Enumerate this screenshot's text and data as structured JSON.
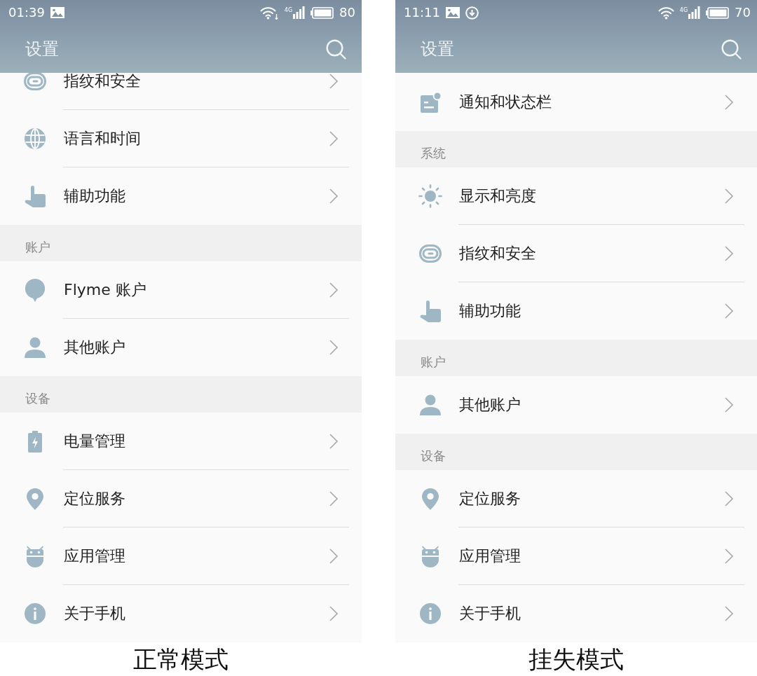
{
  "screens": [
    {
      "status_bar": {
        "time": "01:39",
        "notification_icons": [
          {
            "kind": "image"
          }
        ],
        "wifi_activity": true,
        "network": "4G",
        "battery": "80"
      },
      "app_bar": {
        "title": "设置"
      },
      "sections": [
        {
          "items": [
            {
              "label": "指纹和安全",
              "kind": "fingerprint"
            },
            {
              "label": "语言和时间",
              "kind": "globe"
            },
            {
              "label": "辅助功能",
              "kind": "hand"
            }
          ]
        },
        {
          "header": "账户",
          "items": [
            {
              "label": "Flyme 账户",
              "kind": "balloon"
            },
            {
              "label": "其他账户",
              "kind": "person"
            }
          ]
        },
        {
          "header": "设备",
          "items": [
            {
              "label": "电量管理",
              "kind": "battery"
            },
            {
              "label": "定位服务",
              "kind": "pin"
            },
            {
              "label": "应用管理",
              "kind": "android"
            },
            {
              "label": "关于手机",
              "kind": "info"
            }
          ]
        }
      ],
      "caption": "正常模式"
    },
    {
      "status_bar": {
        "time": "11:11",
        "notification_icons": [
          {
            "kind": "image"
          },
          {
            "kind": "download"
          }
        ],
        "wifi_activity": false,
        "network": "4G",
        "battery": "70"
      },
      "app_bar": {
        "title": "设置"
      },
      "sections": [
        {
          "items": [
            {
              "label": "通知和状态栏",
              "kind": "notification"
            }
          ]
        },
        {
          "header": "系统",
          "items": [
            {
              "label": "显示和亮度",
              "kind": "sun"
            },
            {
              "label": "指纹和安全",
              "kind": "fingerprint"
            },
            {
              "label": "辅助功能",
              "kind": "hand"
            }
          ]
        },
        {
          "header": "账户",
          "items": [
            {
              "label": "其他账户",
              "kind": "person"
            }
          ]
        },
        {
          "header": "设备",
          "items": [
            {
              "label": "定位服务",
              "kind": "pin"
            },
            {
              "label": "应用管理",
              "kind": "android"
            },
            {
              "label": "关于手机",
              "kind": "info"
            }
          ]
        }
      ],
      "caption": "挂失模式"
    }
  ]
}
